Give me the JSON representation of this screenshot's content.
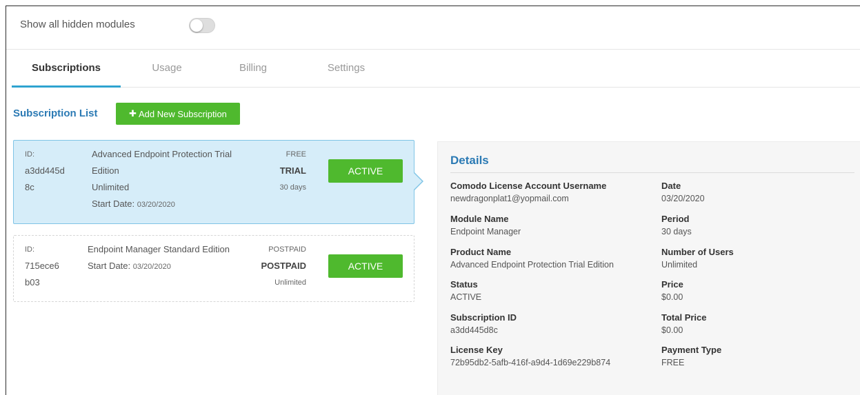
{
  "hidden_modules": {
    "label": "Show all hidden modules",
    "enabled": false
  },
  "tabs": [
    {
      "label": "Subscriptions",
      "active": true
    },
    {
      "label": "Usage",
      "active": false
    },
    {
      "label": "Billing",
      "active": false
    },
    {
      "label": "Settings",
      "active": false
    }
  ],
  "subscription_list": {
    "title": "Subscription List",
    "add_button": "Add New Subscription",
    "add_icon": "plus-icon",
    "items": [
      {
        "id_label": "ID:",
        "id_line1": "a3dd445d",
        "id_line2": "8c",
        "name_line1": "Advanced Endpoint Protection Trial",
        "name_line2": "Edition",
        "users": "Unlimited",
        "start_date_label": "Start Date:",
        "start_date": "03/20/2020",
        "price_type": "FREE",
        "billing_type": "TRIAL",
        "period": "30 days",
        "status": "ACTIVE",
        "selected": true
      },
      {
        "id_label": "ID:",
        "id_line1": "715ece6",
        "id_line2": "b03",
        "name_line1": "Endpoint Manager Standard Edition",
        "start_date_label": "Start Date:",
        "start_date": "03/20/2020",
        "price_type": "POSTPAID",
        "billing_type": "POSTPAID",
        "period": "Unlimited",
        "status": "ACTIVE",
        "selected": false
      }
    ]
  },
  "details": {
    "title": "Details",
    "left": [
      {
        "label": "Comodo License Account Username",
        "value": "newdragonplat1@yopmail.com"
      },
      {
        "label": "Module Name",
        "value": "Endpoint Manager"
      },
      {
        "label": "Product Name",
        "value": "Advanced Endpoint Protection Trial Edition"
      },
      {
        "label": "Status",
        "value": "ACTIVE"
      },
      {
        "label": "Subscription ID",
        "value": "a3dd445d8c"
      },
      {
        "label": "License Key",
        "value": "72b95db2-5afb-416f-a9d4-1d69e229b874"
      }
    ],
    "right": [
      {
        "label": "Date",
        "value": "03/20/2020"
      },
      {
        "label": "Period",
        "value": "30 days"
      },
      {
        "label": "Number of Users",
        "value": "Unlimited"
      },
      {
        "label": "Price",
        "value": "$0.00"
      },
      {
        "label": "Total Price",
        "value": "$0.00"
      },
      {
        "label": "Payment Type",
        "value": "FREE"
      }
    ]
  },
  "colors": {
    "accent_blue": "#2b7ab4",
    "tab_underline": "#2fa3d0",
    "green_button": "#4fb92e",
    "selected_card_bg": "#d6edf9"
  }
}
